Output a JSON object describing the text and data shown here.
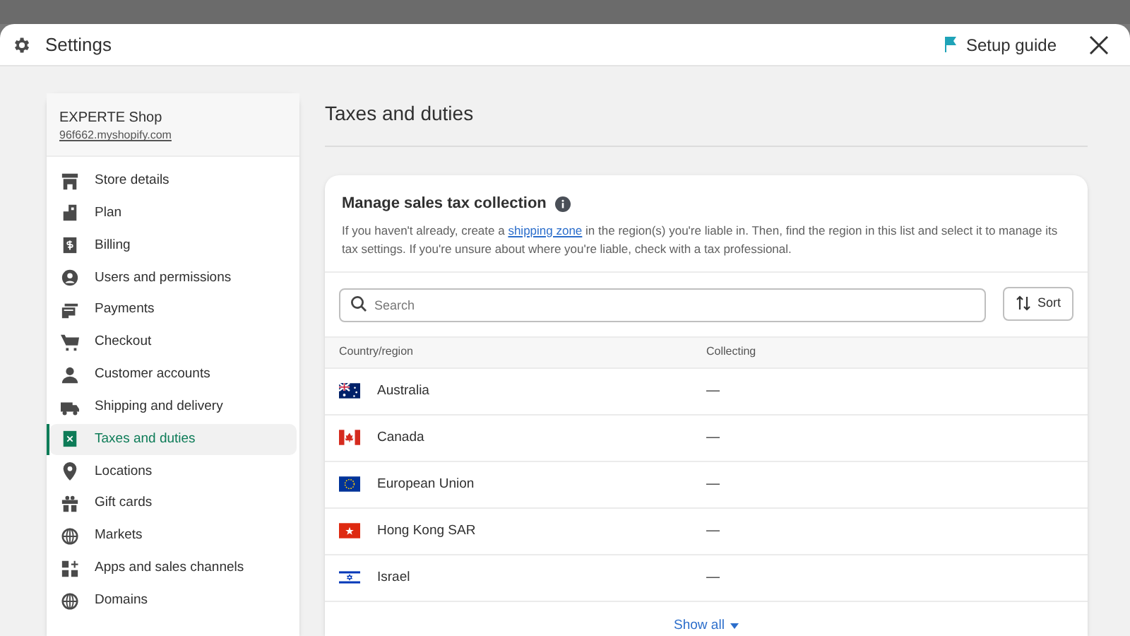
{
  "window": {
    "title": "Settings",
    "setup_guide": "Setup guide"
  },
  "sidebar": {
    "shop_name": "EXPERTE Shop",
    "shop_url": "96f662.myshopify.com",
    "items": [
      {
        "label": "Store details",
        "kind": "store",
        "selected": false
      },
      {
        "label": "Plan",
        "kind": "plan",
        "selected": false
      },
      {
        "label": "Billing",
        "kind": "billing",
        "selected": false
      },
      {
        "label": "Users and permissions",
        "kind": "user",
        "selected": false
      },
      {
        "label": "Payments",
        "kind": "payments",
        "selected": false
      },
      {
        "label": "Checkout",
        "kind": "cart",
        "selected": false
      },
      {
        "label": "Customer accounts",
        "kind": "person",
        "selected": false
      },
      {
        "label": "Shipping and delivery",
        "kind": "truck",
        "selected": false
      },
      {
        "label": "Taxes and duties",
        "kind": "tax",
        "selected": true
      },
      {
        "label": "Locations",
        "kind": "pin",
        "selected": false
      },
      {
        "label": "Gift cards",
        "kind": "gift",
        "selected": false
      },
      {
        "label": "Markets",
        "kind": "globe",
        "selected": false
      },
      {
        "label": "Apps and sales channels",
        "kind": "apps",
        "selected": false
      },
      {
        "label": "Domains",
        "kind": "globe",
        "selected": false
      }
    ]
  },
  "page": {
    "title": "Taxes and duties"
  },
  "card": {
    "title": "Manage sales tax collection",
    "description": {
      "before": "If you haven't already, create a",
      "link": "shipping zone",
      "after": "in the region(s) you're liable in. Then, find the region in this list and select it to manage its tax settings. If you're unsure about where you're liable, check with a tax professional."
    },
    "search": {
      "placeholder": "Search"
    },
    "sort_button": "Sort",
    "table": {
      "columns": [
        "Country/region",
        "Collecting"
      ],
      "rows": [
        {
          "kind": "au",
          "region": "Australia",
          "collecting": "—"
        },
        {
          "kind": "ca",
          "region": "Canada",
          "collecting": "—"
        },
        {
          "kind": "eu",
          "region": "European Union",
          "collecting": "—"
        },
        {
          "kind": "hk",
          "region": "Hong Kong SAR",
          "collecting": "—"
        },
        {
          "kind": "il",
          "region": "Israel",
          "collecting": "—"
        }
      ]
    },
    "show_all": "Show all"
  }
}
